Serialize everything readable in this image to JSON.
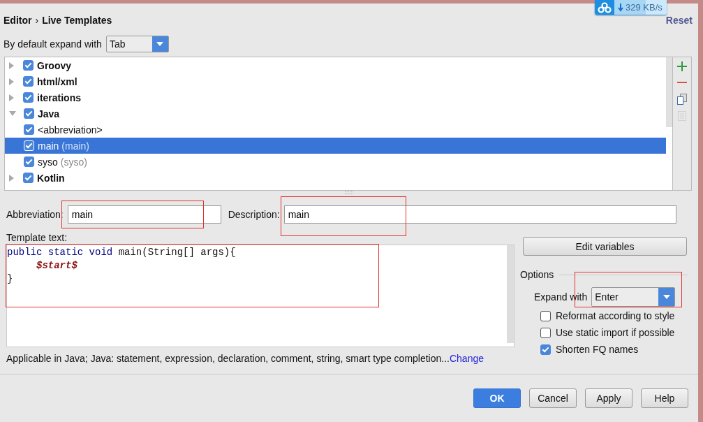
{
  "header": {
    "breadcrumb": [
      "Editor",
      "Live Templates"
    ],
    "separator": "›",
    "reset": "Reset"
  },
  "download_widget": {
    "speed": "329 KB/s"
  },
  "default_expand": {
    "label": "By default expand with",
    "value": "Tab"
  },
  "tree": [
    {
      "kind": "group",
      "name": "Groovy",
      "checked": true,
      "expanded": false,
      "selected": false
    },
    {
      "kind": "group",
      "name": "html/xml",
      "checked": true,
      "expanded": false,
      "selected": false
    },
    {
      "kind": "group",
      "name": "iterations",
      "checked": true,
      "expanded": false,
      "selected": false
    },
    {
      "kind": "group",
      "name": "Java",
      "checked": true,
      "expanded": true,
      "selected": false,
      "children": [
        {
          "kind": "template",
          "name": "<abbreviation>",
          "checked": true,
          "selected": false
        },
        {
          "kind": "template",
          "name": "main",
          "description": "(main)",
          "checked": true,
          "selected": true
        },
        {
          "kind": "template",
          "name": "syso",
          "description": "(syso)",
          "checked": true,
          "selected": false
        }
      ]
    },
    {
      "kind": "group",
      "name": "Kotlin",
      "checked": true,
      "expanded": false,
      "selected": false
    }
  ],
  "tree_tools": [
    {
      "kind": "add",
      "disabled": false
    },
    {
      "kind": "remove",
      "disabled": false
    },
    {
      "kind": "copy",
      "disabled": false
    },
    {
      "kind": "edit",
      "disabled": true
    }
  ],
  "abbreviation": {
    "label": "Abbreviation:",
    "value": "main",
    "annotated": true
  },
  "description": {
    "label": "Description:",
    "value": "main",
    "annotated": true
  },
  "template_text": {
    "label": "Template text:",
    "annotated": true,
    "lines": [
      {
        "indented": false,
        "tokens": [
          {
            "kind": "keyword",
            "text": "public static void"
          },
          {
            "kind": "plain",
            "text": "main(String[] args){"
          }
        ]
      },
      {
        "indented": true,
        "tokens": [
          {
            "kind": "variable",
            "text": "$start$"
          }
        ]
      },
      {
        "indented": false,
        "tokens": [
          {
            "kind": "plain",
            "text": "}"
          }
        ]
      }
    ]
  },
  "edit_variables": "Edit variables",
  "options": {
    "title": "Options",
    "expand_with": {
      "label": "Expand with",
      "value": "Enter",
      "annotated": true
    },
    "checkboxes": [
      {
        "label": "Reformat according to style",
        "checked": false
      },
      {
        "label": "Use static import if possible",
        "checked": false
      },
      {
        "label": "Shorten FQ names",
        "checked": true
      }
    ]
  },
  "applicable": {
    "text": "Applicable in Java; Java: statement, expression, declaration, comment, string, smart type completion...",
    "link": "Change"
  },
  "buttons": [
    {
      "label": "OK",
      "default": true
    },
    {
      "label": "Cancel",
      "default": false
    },
    {
      "label": "Apply",
      "default": false
    },
    {
      "label": "Help",
      "default": false
    }
  ]
}
